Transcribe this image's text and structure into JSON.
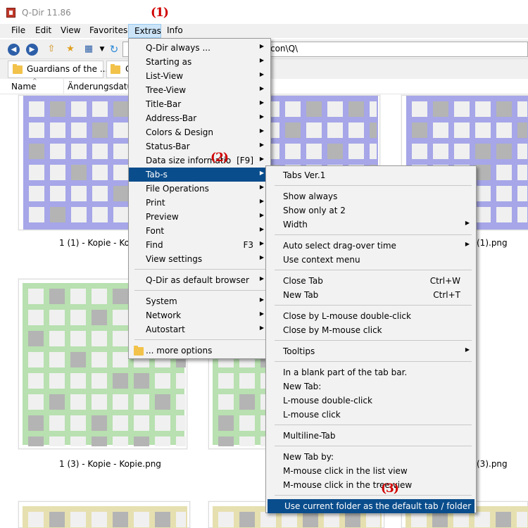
{
  "window": {
    "title": "Q-Dir 11.86"
  },
  "menubar": [
    "File",
    "Edit",
    "View",
    "Favorites",
    "Extras",
    "Info"
  ],
  "address": {
    "value": "g\\icon\\Q\\"
  },
  "tabs": [
    {
      "label": "Guardians of the ..."
    },
    {
      "label": "C"
    }
  ],
  "columns": [
    "Name",
    "Änderungsdatum"
  ],
  "thumbnails": [
    {
      "label": "1 (1) - Kopie - Kopie.png"
    },
    {
      "label": "(1).png"
    },
    {
      "label": "1 (3) - Kopie - Kopie.png"
    },
    {
      "label": "(3).png"
    }
  ],
  "extras_menu": [
    {
      "label": "Q-Dir always ...",
      "submenu": true
    },
    {
      "label": "Starting as",
      "submenu": true
    },
    {
      "label": "List-View",
      "submenu": true
    },
    {
      "label": "Tree-View",
      "submenu": true
    },
    {
      "label": "Title-Bar",
      "submenu": true
    },
    {
      "label": "Address-Bar",
      "submenu": true
    },
    {
      "label": "Colors & Design",
      "submenu": true
    },
    {
      "label": "Status-Bar",
      "submenu": true
    },
    {
      "label": "Data size informatio",
      "shortcut": "[F9]",
      "submenu": true
    },
    {
      "label": "Tab-s",
      "submenu": true,
      "selected": true
    },
    {
      "label": "File Operations",
      "submenu": true
    },
    {
      "label": "Print",
      "submenu": true
    },
    {
      "label": "Preview",
      "submenu": true
    },
    {
      "label": "Font",
      "submenu": true
    },
    {
      "label": "Find",
      "shortcut": "F3",
      "submenu": true
    },
    {
      "label": "View settings",
      "submenu": true
    },
    {
      "separator": true
    },
    {
      "label": "Q-Dir as default browser",
      "submenu": true
    },
    {
      "separator": true
    },
    {
      "label": "System",
      "submenu": true
    },
    {
      "label": "Network",
      "submenu": true
    },
    {
      "label": "Autostart",
      "submenu": true
    },
    {
      "separator": true
    },
    {
      "label": "... more options",
      "icon": "folder-icon"
    }
  ],
  "tabs_submenu": [
    {
      "label": "Tabs Ver.1"
    },
    {
      "separator": true
    },
    {
      "label": "Show always"
    },
    {
      "label": "Show only at 2"
    },
    {
      "label": "Width",
      "submenu": true
    },
    {
      "separator": true
    },
    {
      "label": "Auto select drag-over time",
      "submenu": true
    },
    {
      "label": "Use context menu"
    },
    {
      "separator": true
    },
    {
      "label": "Close Tab",
      "shortcut": "Ctrl+W"
    },
    {
      "label": "New Tab",
      "shortcut": "Ctrl+T"
    },
    {
      "separator": true
    },
    {
      "label": "Close by L-mouse double-click"
    },
    {
      "label": "Close by M-mouse click"
    },
    {
      "separator": true
    },
    {
      "label": "Tooltips",
      "submenu": true
    },
    {
      "separator": true
    },
    {
      "label": "In a blank part of the tab bar."
    },
    {
      "label": "New Tab:"
    },
    {
      "label": "L-mouse double-click"
    },
    {
      "label": "L-mouse click"
    },
    {
      "separator": true
    },
    {
      "label": "Multiline-Tab"
    },
    {
      "separator": true
    },
    {
      "label": "New Tab by:"
    },
    {
      "label": "M-mouse click in the list view"
    },
    {
      "label": "M-mouse click in the tree view"
    },
    {
      "separator": true
    },
    {
      "label": "Use current folder as the default tab / folder",
      "selected": true
    }
  ],
  "annotations": [
    "(1)",
    "(2)",
    "(3)"
  ],
  "colors": {
    "selection": "#0a4d8c",
    "annotation": "#d00000",
    "purple": "#a6a6e8",
    "green": "#b8e0b0",
    "yellow": "#e6e0b0"
  }
}
